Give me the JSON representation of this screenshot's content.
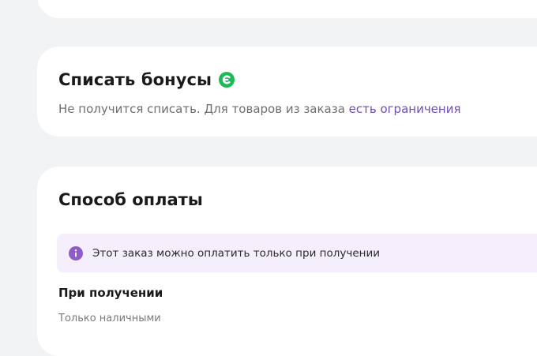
{
  "bonus": {
    "title": "Списать бонусы",
    "icon": "bonus-coin-icon",
    "icon_color": "#1db954",
    "subtitle_prefix": "Не получится списать. Для товаров из заказа ",
    "subtitle_link": "есть ограничения",
    "link_color": "#6f4fb0"
  },
  "payment": {
    "title": "Способ оплаты",
    "notice": {
      "icon": "info-icon",
      "icon_color": "#8e5cc9",
      "text": "Этот заказ можно оплатить только при получении",
      "background": "#f5eefc"
    },
    "method": {
      "title": "При получении",
      "subtitle": "Только наличными"
    }
  }
}
